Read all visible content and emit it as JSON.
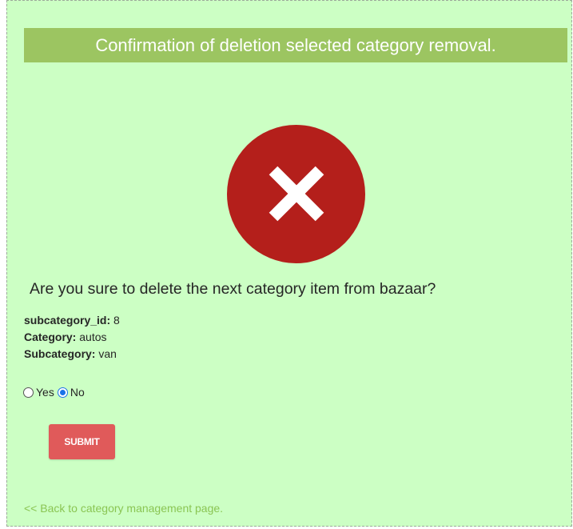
{
  "header": {
    "title": "Confirmation of deletion selected category removal."
  },
  "icon": {
    "name": "error-x-icon",
    "circle_color": "#b41f1b"
  },
  "question": "Are you sure to delete the next category item from bazaar?",
  "details": {
    "subcategory_id_label": "subcategory_id:",
    "subcategory_id_value": "8",
    "category_label": "Category:",
    "category_value": "autos",
    "subcategory_label": "Subcategory:",
    "subcategory_value": "van"
  },
  "confirm": {
    "yes_label": "Yes",
    "no_label": "No",
    "selected": "No"
  },
  "submit_label": "SUBMIT",
  "back_link": "<< Back to category management page.",
  "colors": {
    "background": "#ccffc4",
    "title_bar": "#9cc561",
    "submit_button": "#e05a5a",
    "link": "#8ac553"
  }
}
